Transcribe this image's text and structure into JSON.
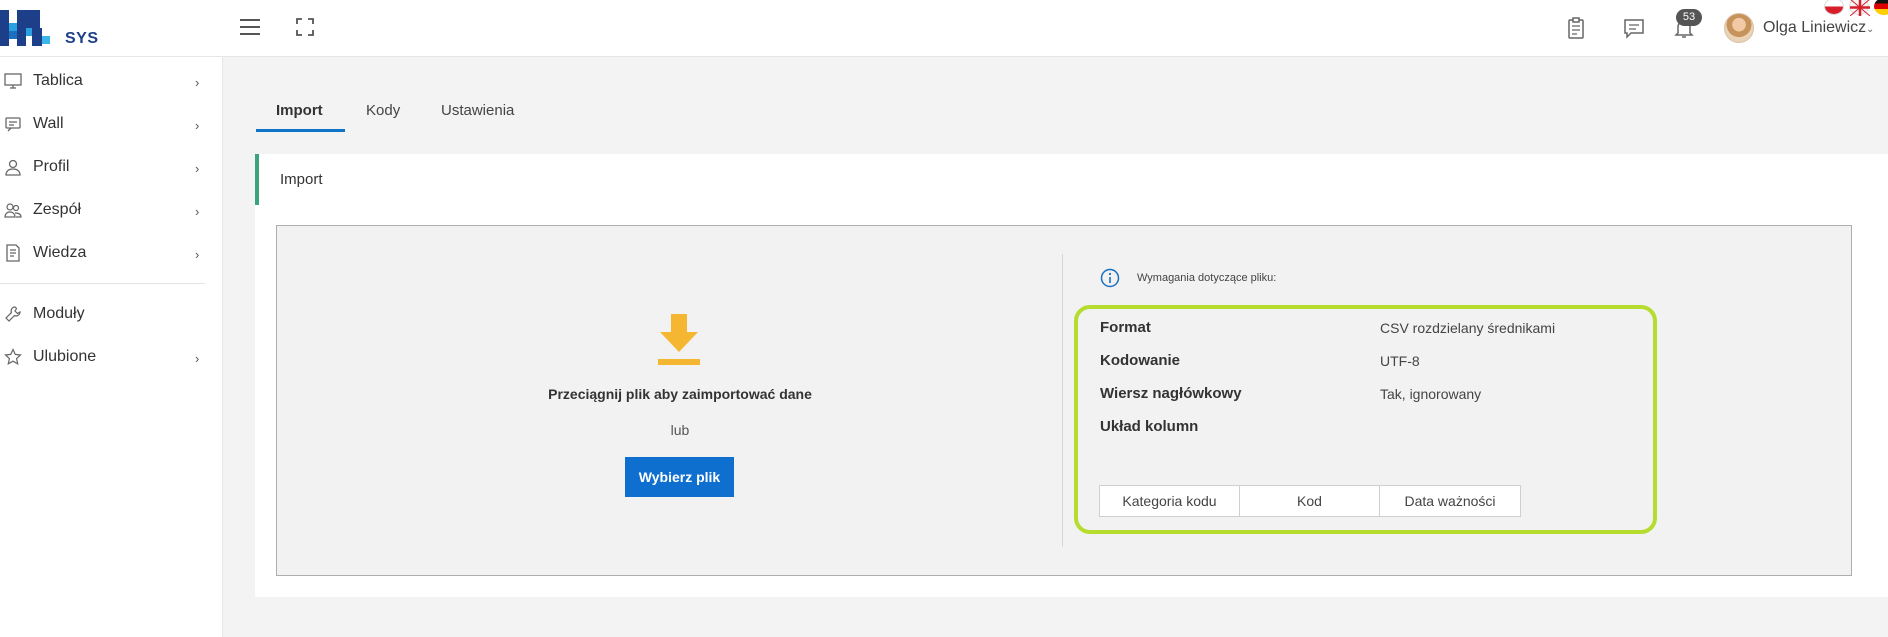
{
  "header": {
    "logo_text": "SYS",
    "notification_count": "53",
    "user_name": "Olga Liniewicz",
    "caret": "⌄"
  },
  "sidebar": {
    "items": [
      {
        "label": "Tablica",
        "chevron": "›"
      },
      {
        "label": "Wall",
        "chevron": "›"
      },
      {
        "label": "Profil",
        "chevron": "›"
      },
      {
        "label": "Zespół",
        "chevron": "›"
      },
      {
        "label": "Wiedza",
        "chevron": "›"
      },
      {
        "label": "Moduły"
      },
      {
        "label": "Ulubione",
        "chevron": "›"
      }
    ]
  },
  "tabs": [
    {
      "label": "Import",
      "active": true
    },
    {
      "label": "Kody",
      "active": false
    },
    {
      "label": "Ustawienia",
      "active": false
    }
  ],
  "panel": {
    "title": "Import",
    "drop_text": "Przeciągnij plik aby zaimportować dane",
    "or_text": "lub",
    "choose_button": "Wybierz plik",
    "requirements_title": "Wymagania dotyczące pliku:",
    "requirements": [
      {
        "label": "Format",
        "value": "CSV rozdzielany średnikami"
      },
      {
        "label": "Kodowanie",
        "value": "UTF-8"
      },
      {
        "label": "Wiersz nagłówkowy",
        "value": "Tak, ignorowany"
      },
      {
        "label": "Układ kolumn",
        "value": ""
      }
    ],
    "columns": [
      "Kategoria kodu",
      "Kod",
      "Data ważności"
    ]
  },
  "colors": {
    "accent_blue": "#0f6fcf",
    "highlight_green": "#b5dc2e",
    "panel_accent": "#3aa47b",
    "download_icon": "#f5b731"
  }
}
